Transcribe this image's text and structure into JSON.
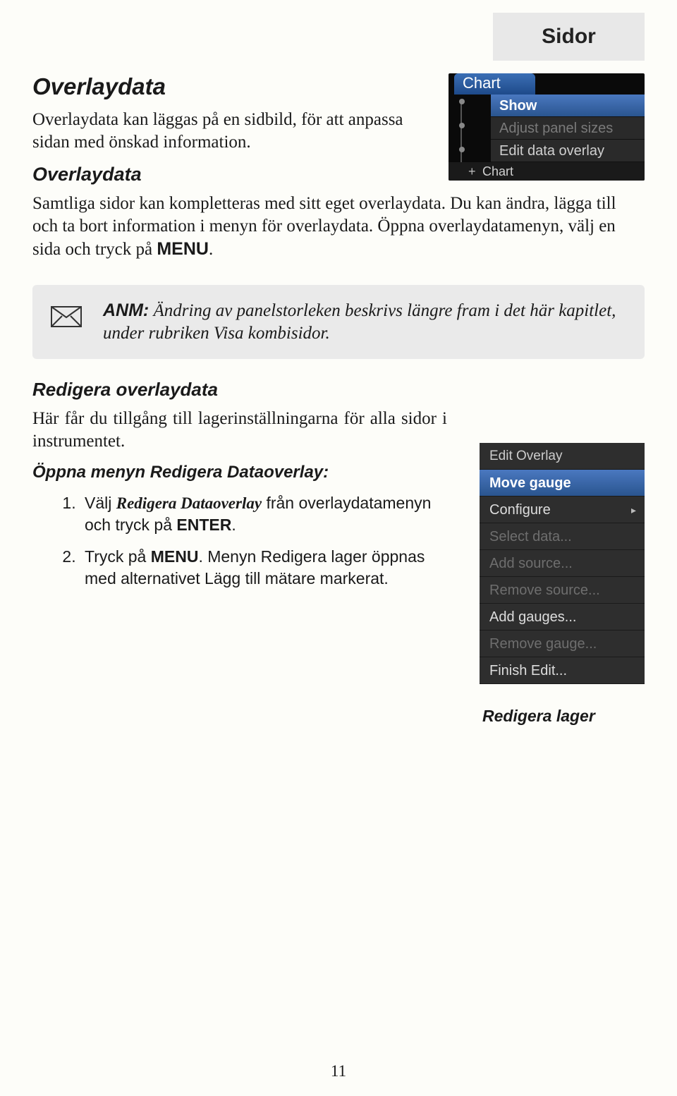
{
  "header": {
    "tab": "Sidor"
  },
  "s1": {
    "heading": "Overlaydata",
    "p1": "Overlaydata kan läggas på en sidbild, för att anpassa sidan med önskad information.",
    "sub": "Overlaydata",
    "p2a": "Samtliga sidor kan kompletteras med sitt eget overlaydata. Du kan ändra, lägga till och ta bort information i menyn för overlaydata. Öppna overlaydatamenyn, välj en sida och tryck på ",
    "p2b": "MENU",
    "p2c": "."
  },
  "overlay_menu": {
    "tab": "Chart",
    "items": [
      "Show",
      "Adjust panel sizes",
      "Edit data overlay"
    ],
    "bottom": "Chart"
  },
  "note": {
    "label": "ANM:",
    "text": " Ändring av panelstorleken beskrivs längre fram i det här kapitlet, under rubriken Visa kombisidor."
  },
  "s2": {
    "heading": "Redigera overlaydata",
    "p1": "Här får du tillgång till lagerinställningarna för alla sidor i instrumentet.",
    "sub": "Öppna menyn Redigera Dataoverlay:",
    "li1a": "Välj ",
    "li1b": "Redigera Dataoverlay",
    "li1c": " från overlaydatamenyn och tryck på ",
    "li1d": "ENTER",
    "li1e": ".",
    "li2a": "Tryck på ",
    "li2b": "MENU",
    "li2c": ". Menyn Redigera lager öppnas med alternativet Lägg till mätare markerat."
  },
  "edit_menu": {
    "items": [
      "Edit Overlay",
      "Move gauge",
      "Configure",
      "Select data...",
      "Add source...",
      "Remove source...",
      "Add gauges...",
      "Remove gauge...",
      "Finish Edit..."
    ],
    "caption": "Redigera lager"
  },
  "page_num": "11"
}
